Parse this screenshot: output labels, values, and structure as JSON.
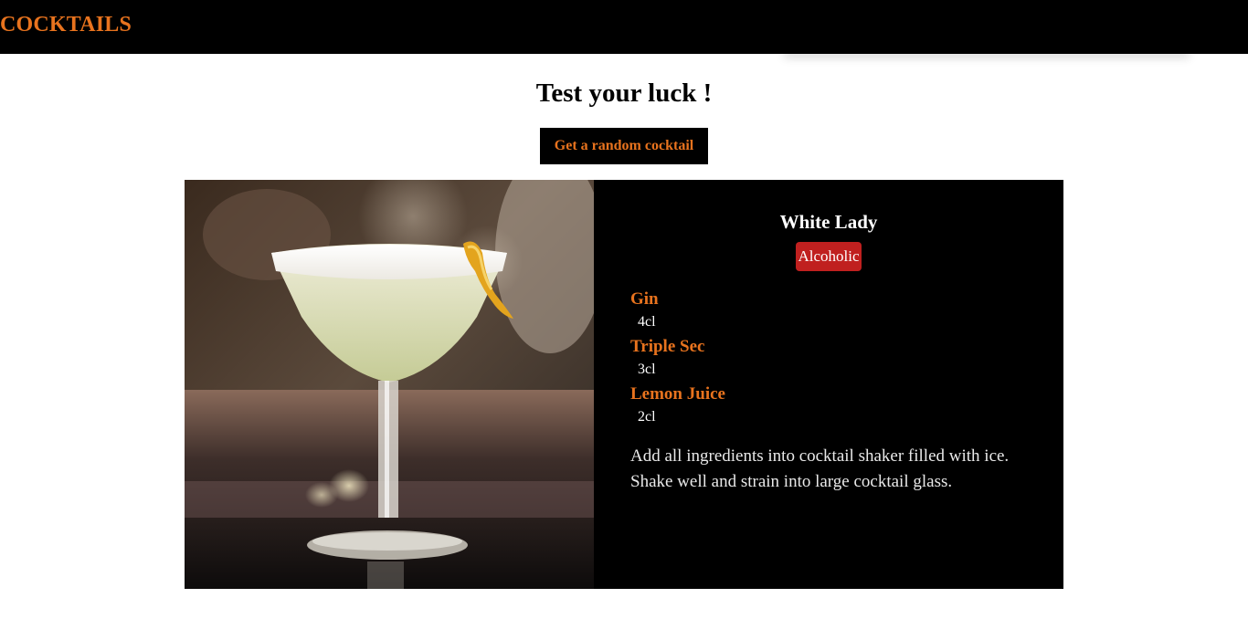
{
  "nav": {
    "brand": "COCKTAILS"
  },
  "main": {
    "title": "Test your luck !",
    "random_button_label": "Get a random cocktail"
  },
  "cocktail": {
    "name": "White Lady",
    "category_badge": "Alcoholic",
    "ingredients": [
      {
        "name": "Gin",
        "measure": "4cl"
      },
      {
        "name": "Triple Sec",
        "measure": "3cl"
      },
      {
        "name": "Lemon Juice",
        "measure": "2cl"
      }
    ],
    "instructions": "Add all ingredients into cocktail shaker filled with ice. Shake well and strain into large cocktail glass."
  },
  "colors": {
    "accent": "#e8731e",
    "badge": "#c0201f",
    "navbar": "#000000",
    "card": "#000000"
  }
}
